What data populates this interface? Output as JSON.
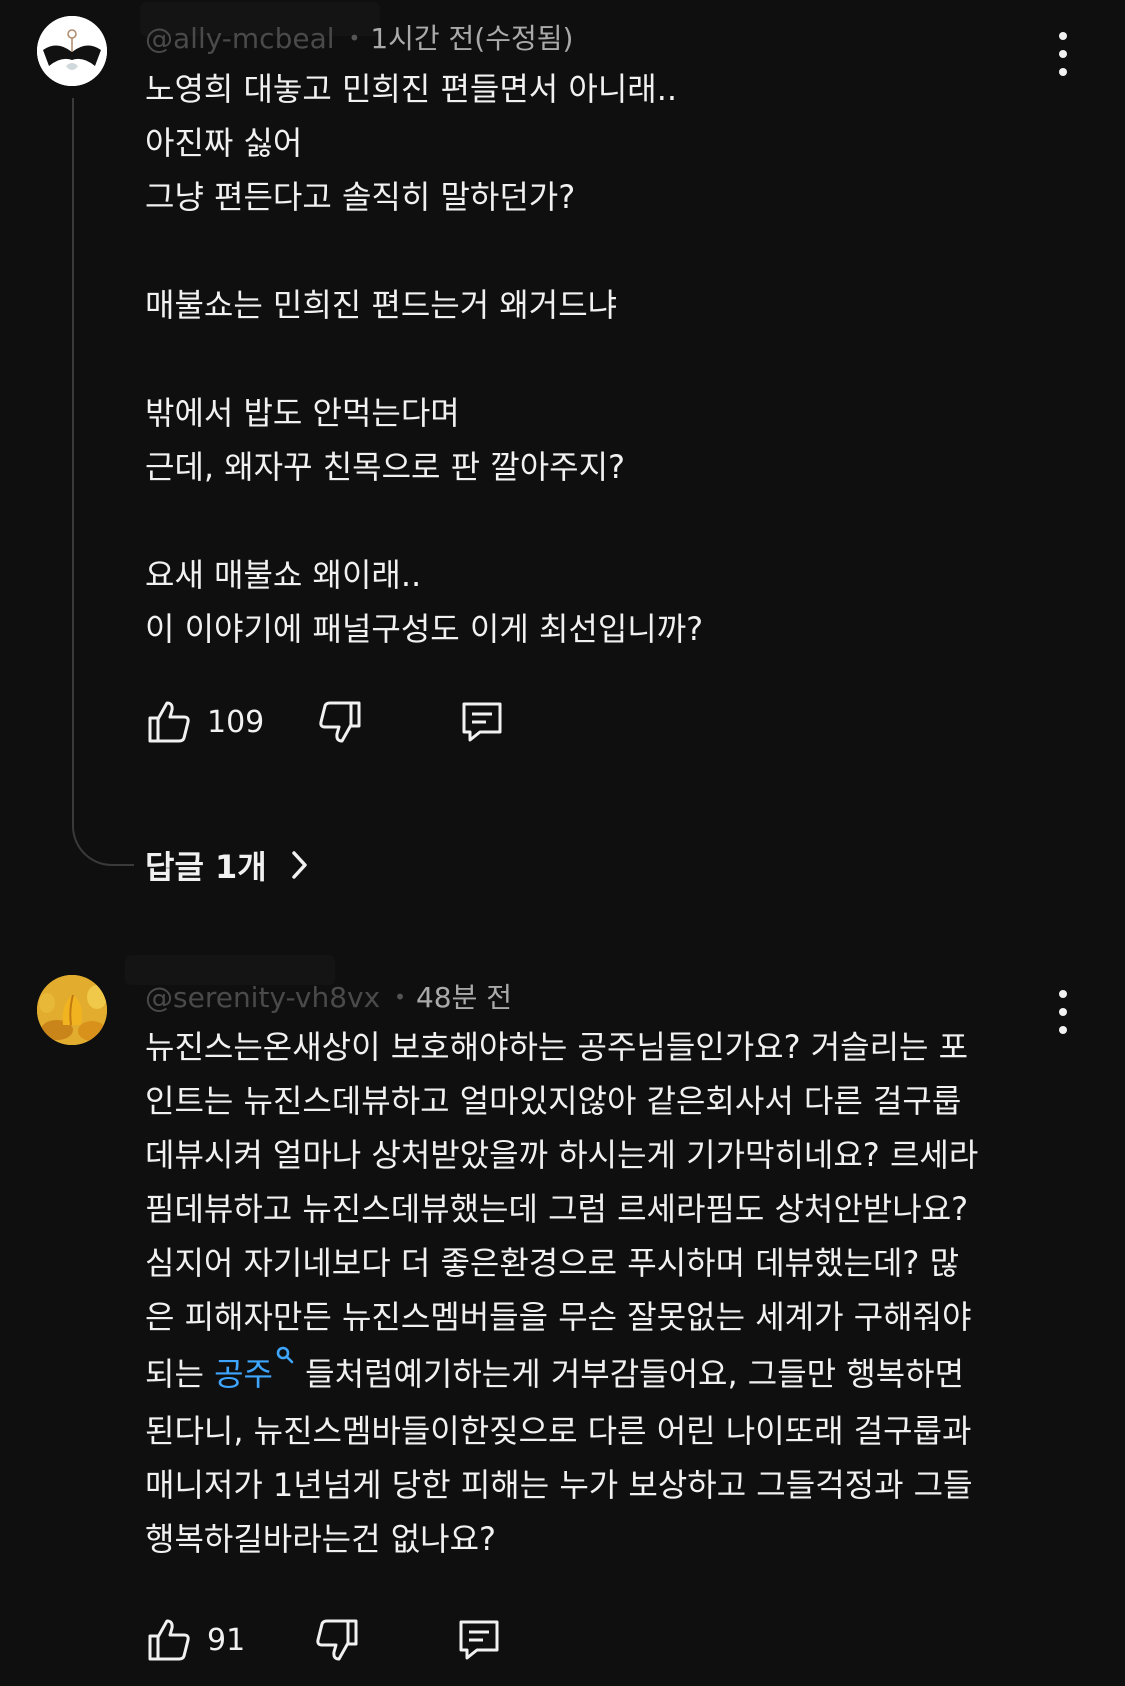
{
  "comments": [
    {
      "handle": "@ally-mcbeal",
      "time": "1시간 전(수정됨)",
      "lines": [
        "노영희 대놓고 민희진 편들면서 아니래..",
        "아진짜 싫어",
        "그냥 편든다고 솔직히 말하던가?",
        "",
        "매불쇼는 민희진 편드는거 왜거드냐",
        "",
        "밖에서 밥도 안먹는다며",
        "근데, 왜자꾸 친목으로 판 깔아주지?",
        "",
        "요새 매불쇼 왜이래..",
        "이 이야기에 패널구성도 이게 최선입니까?"
      ],
      "likes": "109",
      "replies_label": "답글 1개"
    },
    {
      "handle": "@serenity-vh8vx",
      "time": "48분 전",
      "lines": [
        "뉴진스는온새상이 보호해야하는 공주님들인가요? 거슬리는 포",
        "인트는 뉴진스데뷰하고 얼마있지않아 같은회사서 다른 걸구룹",
        "데뷰시켜 얼마나 상처받았을까 하시는게 기가막히네요?  르세라",
        "핌데뷰하고 뉴진스데뷰했는데 그럼 르세라핌도 상처안받나요?",
        "심지어 자기네보다 더 좋은환경으로 푸시하며 데뷰했는데?  많",
        "은 피해자만든 뉴진스멤버들을 무슨 잘못없는 세계가 구해줘야"
      ],
      "line7_prefix": "되는 ",
      "line7_link": "공주",
      "line7_suffix": " 들처럼예기하는게 거부감들어요,  그들만 행복하면",
      "lines_after": [
        "된다니, 뉴진스멤바들이한짖으로 다른 어린 나이또래 걸구룹과",
        "매니저가 1년넘게 당한 피해는 누가 보상하고 그들걱정과 그들",
        "행복하길바라는건 없나요?"
      ],
      "likes": "91"
    }
  ],
  "icons": {
    "like": "thumbs-up-icon",
    "dislike": "thumbs-down-icon",
    "reply": "comment-icon",
    "menu": "more-vert-icon",
    "search": "search-icon",
    "chevron": "chevron-right-icon"
  },
  "colors": {
    "background": "#0f0f0f",
    "text": "#f1f1f1",
    "meta": "#aaaaaa",
    "link": "#3ea6ff"
  }
}
